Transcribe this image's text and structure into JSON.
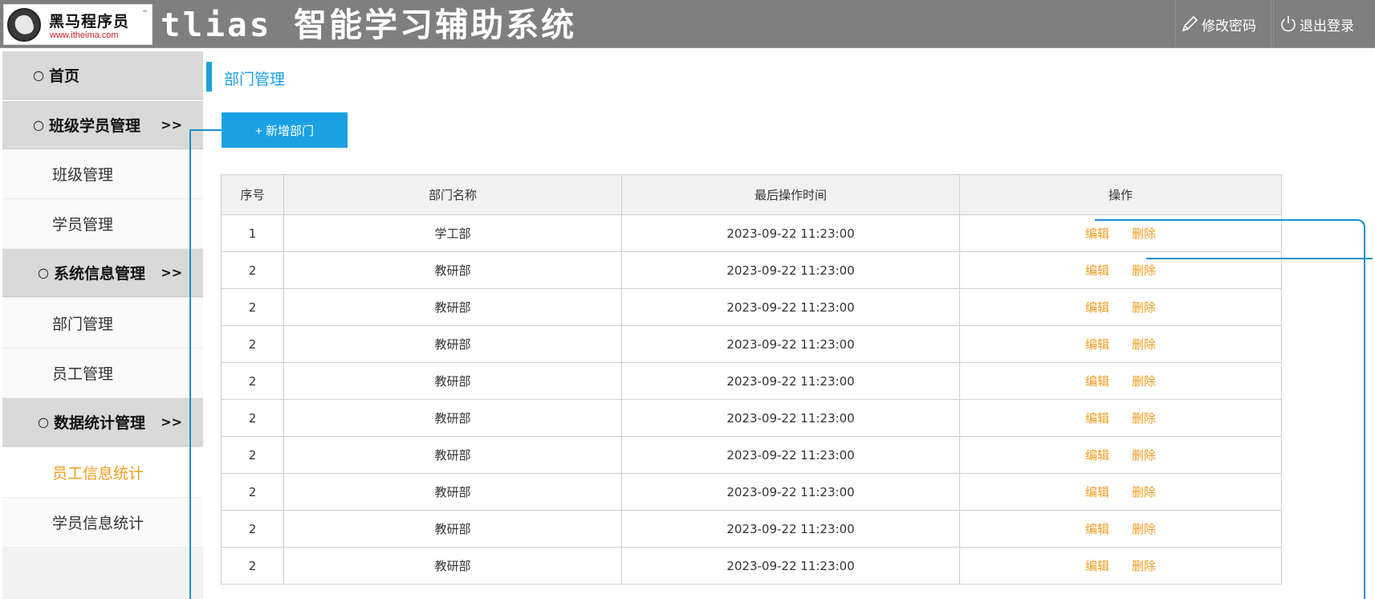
{
  "header": {
    "logo_text": "黑马程序员",
    "logo_tm": "™",
    "logo_url": "www.itheima.com",
    "app_title": "tlias 智能学习辅助系统",
    "change_password": "修改密码",
    "logout": "退出登录"
  },
  "sidebar": {
    "home": "首页",
    "groups": [
      {
        "label": "班级学员管理",
        "arrow": ">>",
        "items": [
          "班级管理",
          "学员管理"
        ]
      },
      {
        "label": "系统信息管理",
        "arrow": ">>",
        "items": [
          "部门管理",
          "员工管理"
        ]
      },
      {
        "label": "数据统计管理",
        "arrow": ">>",
        "items": [
          "员工信息统计",
          "学员信息统计"
        ]
      }
    ],
    "bullet": "○",
    "active_item": "员工信息统计"
  },
  "content": {
    "breadcrumb": "部门管理",
    "add_button": "+ 新增部门",
    "table": {
      "headers": [
        "序号",
        "部门名称",
        "最后操作时间",
        "操作"
      ],
      "edit_label": "编辑",
      "delete_label": "删除",
      "rows": [
        {
          "idx": "1",
          "name": "学工部",
          "time": "2023-09-22 11:23:00"
        },
        {
          "idx": "2",
          "name": "教研部",
          "time": "2023-09-22 11:23:00"
        },
        {
          "idx": "2",
          "name": "教研部",
          "time": "2023-09-22 11:23:00"
        },
        {
          "idx": "2",
          "name": "教研部",
          "time": "2023-09-22 11:23:00"
        },
        {
          "idx": "2",
          "name": "教研部",
          "time": "2023-09-22 11:23:00"
        },
        {
          "idx": "2",
          "name": "教研部",
          "time": "2023-09-22 11:23:00"
        },
        {
          "idx": "2",
          "name": "教研部",
          "time": "2023-09-22 11:23:00"
        },
        {
          "idx": "2",
          "name": "教研部",
          "time": "2023-09-22 11:23:00"
        },
        {
          "idx": "2",
          "name": "教研部",
          "time": "2023-09-22 11:23:00"
        },
        {
          "idx": "2",
          "name": "教研部",
          "time": "2023-09-22 11:23:00"
        }
      ]
    }
  },
  "colors": {
    "header_bg": "#7f7f7f",
    "accent_blue": "#1aa1e4",
    "link_orange": "#f39c1e",
    "group_bg": "#d9d9d9"
  }
}
